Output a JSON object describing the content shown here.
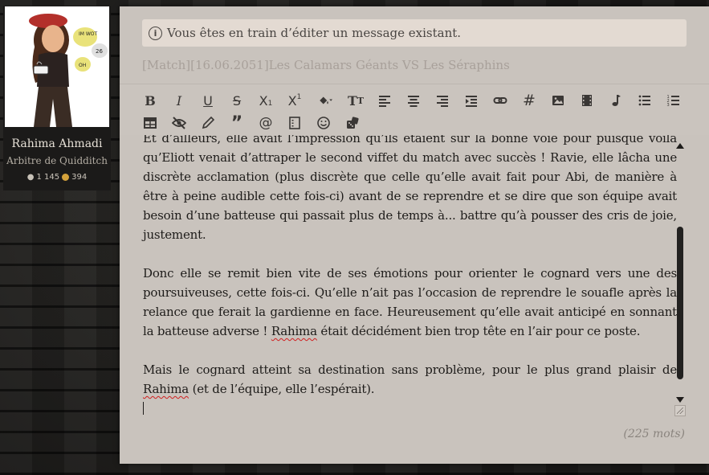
{
  "profile": {
    "name": "Rahima Ahmadi",
    "role": "Arbitre de Quidditch",
    "posts": "1 145",
    "coins": "394",
    "avatar_text_1": "IM WOT",
    "avatar_text_2": "26",
    "avatar_text_3": "OH"
  },
  "editor": {
    "notice": "Vous êtes en train d’éditer un message existant.",
    "title": "[Match][16.06.2051]Les Calamars Géants VS Les Séraphins",
    "paragraphs": [
      "Et d’ailleurs, elle avait l’impression qu’ils étaient sur la bonne voie pour puisque voilà qu’Eliott venait d’attraper le second viffet du match avec succès ! Ravie, elle lâcha une discrète acclamation (plus discrète que celle qu’elle avait fait pour Abi, de manière à être à peine audible cette fois-ci) avant de se reprendre et se dire que son équipe avait besoin d’une batteuse qui passait plus de temps à... battre qu’à pousser des cris de joie, justement.",
      "Donc elle se remit bien vite de ses émotions pour orienter le cognard vers une des poursuiveuses, cette fois-ci. Qu’elle n’ait pas l’occasion de reprendre le souafle après la relance que ferait la gardienne en face. Heureusement qu’elle avait anticipé en sonnant la batteuse adverse !",
      "Mais le cognard atteint sa destination sans problème, pour le plus grand plaisir de"
    ],
    "p2_tail_name": "Rahima",
    "p2_tail_rest": " était décidément bien trop tête en l’air pour ce poste.",
    "p3_name": "Rahima",
    "p3_rest": " (et de l’équipe, elle l’espérait).",
    "word_count": "(225 mots)"
  },
  "toolbar": {
    "row1": [
      "bold-icon",
      "italic-icon",
      "underline-icon",
      "strikethrough-icon",
      "subscript-icon",
      "superscript-icon",
      "color-fill-icon",
      "font-size-icon",
      "align-left-icon",
      "align-center-icon",
      "align-right-icon",
      "indent-icon",
      "link-icon",
      "hashtag-icon",
      "image-icon",
      "video-icon",
      "music-icon",
      "bullet-list-icon",
      "numbered-list-icon"
    ],
    "row2": [
      "table-icon",
      "hide-icon",
      "pencil-icon",
      "quote-icon",
      "mention-icon",
      "code-block-icon",
      "emoji-icon",
      "dice-icon"
    ]
  },
  "colors": {
    "editor_bg": "#c9c3bd",
    "notice_bg": "#e3dad2",
    "coin": "#d4a23b",
    "spellcheck": "#d02020"
  }
}
